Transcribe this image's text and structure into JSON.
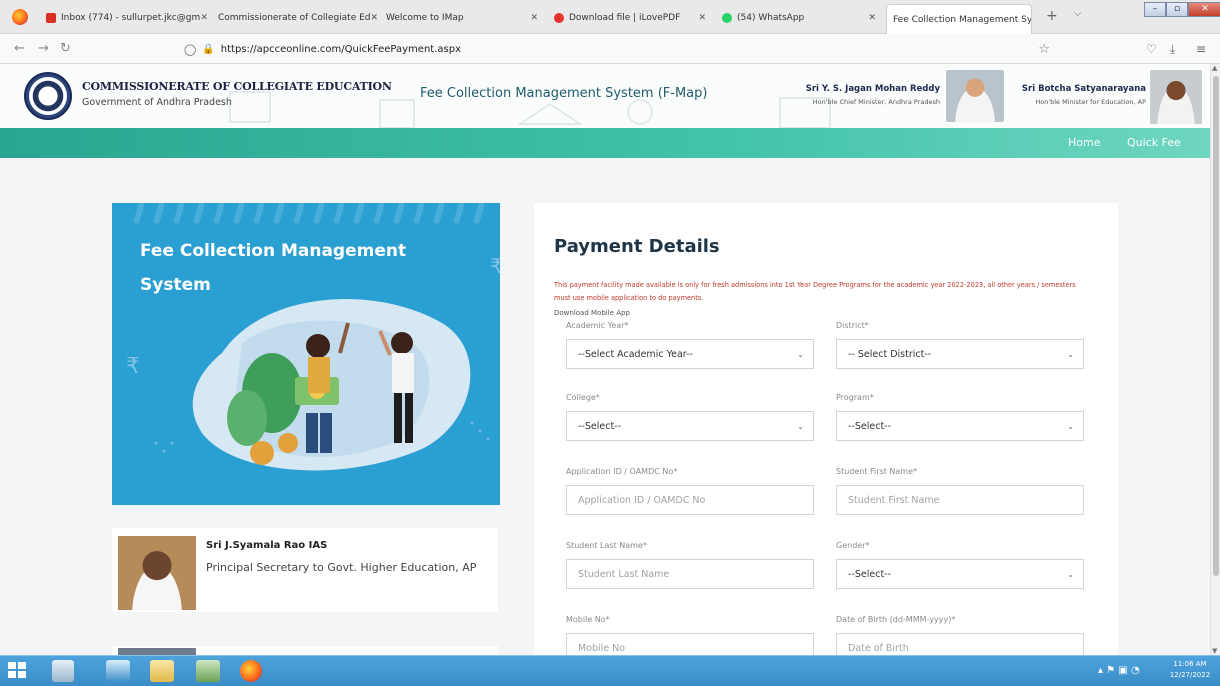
{
  "browser": {
    "tabs": [
      {
        "title": "Inbox (774) - sullurpet.jkc@gm",
        "close": "✕"
      },
      {
        "title": "Commissionerate of Collegiate Ed",
        "close": "✕"
      },
      {
        "title": "Welcome to IMap",
        "close": "✕"
      },
      {
        "title": "Download file | iLovePDF",
        "close": "✕"
      },
      {
        "title": "(54) WhatsApp",
        "close": "✕"
      },
      {
        "title": "Fee Collection Management Syste",
        "close": "✕"
      }
    ],
    "new_tab": "+",
    "tab_menu": "⌵",
    "url": "https://apcceonline.com/QuickFeePayment.aspx",
    "window_buttons": {
      "minimize": "–",
      "maximize": "▫",
      "close": "✕"
    }
  },
  "header": {
    "dept_title": "COMMISSIONERATE OF COLLEGIATE EDUCATION",
    "dept_sub": "Government of Andhra Pradesh",
    "site_title": "Fee Collection Management System (F-Map)",
    "cm_name": "Sri Y. S. Jagan Mohan Reddy",
    "cm_role": "Hon'ble Chief Minister, Andhra Pradesh",
    "em_name": "Sri Botcha Satyanarayana",
    "em_role": "Hon'ble Minister for Education, AP"
  },
  "nav": {
    "home": "Home",
    "quick_fee": "Quick Fee"
  },
  "hero": {
    "title_line1": "Fee Collection Management",
    "title_line2": "System"
  },
  "officer": {
    "name": "Sri J.Syamala Rao IAS",
    "role": "Principal Secretary to Govt. Higher Education, AP"
  },
  "form": {
    "title": "Payment Details",
    "notice": "This payment facility made available is only for fresh admissions into 1st Year Degree Programs for the academic year 2022-2023, all other years / semesters must use mobile application to do payments.",
    "download_link": "Download Mobile App",
    "fields": {
      "academic_year": {
        "label": "Academic Year*",
        "value": "--Select Academic Year--"
      },
      "district": {
        "label": "District*",
        "value": "-- Select District--"
      },
      "college": {
        "label": "College*",
        "value": "--Select--"
      },
      "program": {
        "label": "Program*",
        "value": "--Select--"
      },
      "application_id": {
        "label": "Application ID / OAMDC No*",
        "placeholder": "Application ID / OAMDC No"
      },
      "first_name": {
        "label": "Student First Name*",
        "placeholder": "Student First Name"
      },
      "last_name": {
        "label": "Student Last Name*",
        "placeholder": "Student Last Name"
      },
      "gender": {
        "label": "Gender*",
        "value": "--Select--"
      },
      "mobile": {
        "label": "Mobile No*",
        "placeholder": "Mobile No"
      },
      "dob": {
        "label": "Date of Birth (dd-MMM-yyyy)*",
        "placeholder": "Date of Birth"
      }
    }
  },
  "taskbar": {
    "time": "11:06 AM",
    "date": "12/27/2022"
  },
  "colors": {
    "teal": "#2aa591",
    "hero_blue": "#2a9fd1",
    "notice_red": "#c0392b",
    "title_navy": "#1e3447"
  }
}
